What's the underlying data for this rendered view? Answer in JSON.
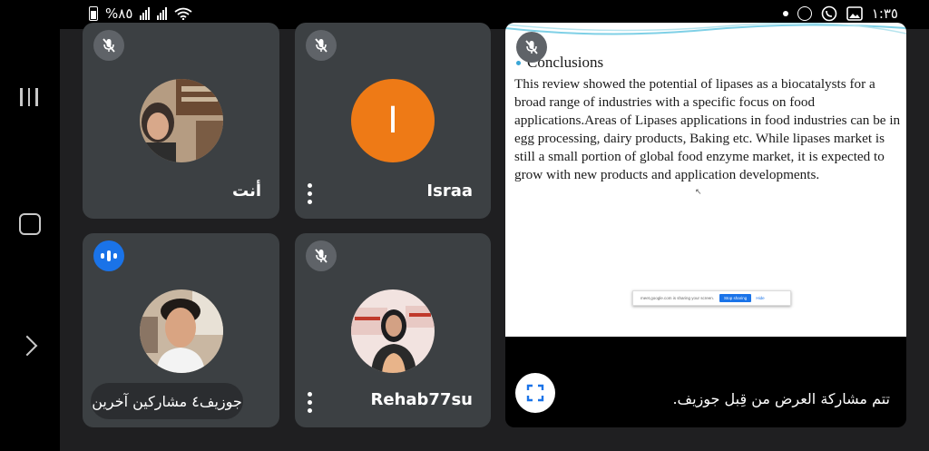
{
  "status_bar": {
    "battery_percent": "%٨٥",
    "time": "١:٣٥",
    "icons": [
      "battery-icon",
      "signal-icon",
      "signal-icon",
      "wifi-icon",
      "notification-dot-icon",
      "circle-app-icon",
      "whatsapp-icon",
      "gallery-icon"
    ]
  },
  "nav_bar": {
    "icons": [
      "recents-icon",
      "home-icon",
      "back-icon"
    ]
  },
  "tiles": {
    "you": {
      "name": "أنت",
      "mic": "muted"
    },
    "israa": {
      "name": "Israa",
      "initial": "I",
      "avatar_color": "#ee7a16",
      "mic": "muted"
    },
    "joseph": {
      "name": "جوزيف",
      "mic": "speaking"
    },
    "rehab": {
      "name": "Rehab77su",
      "mic": "muted"
    }
  },
  "others_pill": "٤ مشاركين آخرين",
  "presentation": {
    "slide_title": "Conclusions",
    "slide_body": "This review showed the potential of lipases as a biocatalysts for a broad range of industries with a specific focus on food applications.Areas of Lipases applications in food industries can be in egg processing, dairy products, Baking etc. While lipases market is still a small portion of global food enzyme market, it is expected to grow with new products and application developments.",
    "share_bar_text": "meet.google.com is sharing your screen.",
    "stop_sharing_label": "Stop sharing",
    "hide_label": "Hide",
    "caption": "تتم مشاركة العرض من قِبل جوزيف.",
    "mic": "muted"
  },
  "colors": {
    "background": "#1f1f21",
    "tile": "#3c4043",
    "mute_badge": "#5f6368",
    "speaking_badge": "#1a73e8",
    "israa_avatar": "#ee7a16"
  }
}
